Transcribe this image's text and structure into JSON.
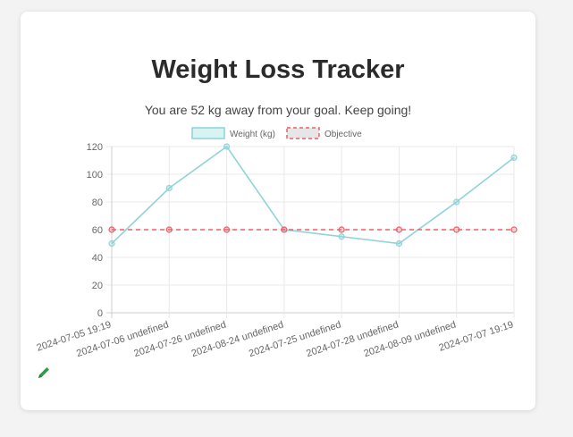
{
  "header": {
    "title": "Weight Loss Tracker",
    "message": "You are 52 kg away from your goal. Keep going!"
  },
  "colors": {
    "weight_line": "#8fd3d8",
    "weight_fill": "#d8f3f4",
    "objective_line": "#e8606a",
    "objective_fill": "#e6e6e6",
    "edit_icon": "#2e9e45"
  },
  "chart_data": {
    "type": "line",
    "categories": [
      "2024-07-05 19:19",
      "2024-07-06 undefined",
      "2024-07-26 undefined",
      "2024-08-24 undefined",
      "2024-07-25 undefined",
      "2024-07-28 undefined",
      "2024-08-09 undefined",
      "2024-07-07 19:19"
    ],
    "series": [
      {
        "name": "Weight (kg)",
        "values": [
          50,
          90,
          120,
          60,
          55,
          50,
          80,
          112
        ]
      },
      {
        "name": "Objective",
        "values": [
          60,
          60,
          60,
          60,
          60,
          60,
          60,
          60
        ],
        "dashed": true
      }
    ],
    "ylim": [
      0,
      120
    ],
    "yticks": [
      "0",
      "20",
      "40",
      "60",
      "80",
      "100",
      "120"
    ],
    "grid": true,
    "legend": "top"
  },
  "actions": {
    "edit_icon": "pencil-icon"
  }
}
